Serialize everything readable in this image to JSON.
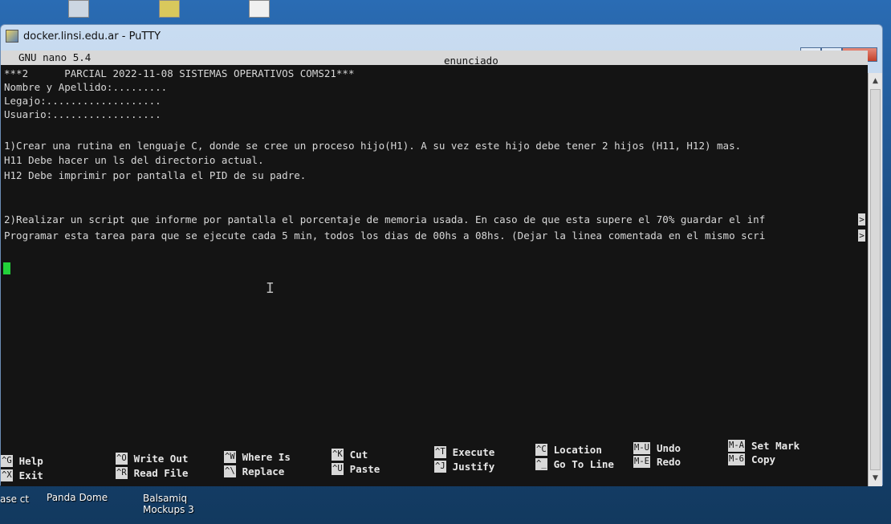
{
  "window": {
    "title": "docker.linsi.edu.ar - PuTTY",
    "buttons": [
      "–",
      "□",
      "X"
    ]
  },
  "nano": {
    "version": "GNU nano 5.4",
    "filename": "enunciado"
  },
  "document": {
    "lines": [
      "***2      PARCIAL 2022-11-08 SISTEMAS OPERATIVOS COMS21***",
      "Nombre y Apellido:.........",
      "Legajo:...................",
      "Usuario:..................",
      "",
      "1)Crear una rutina en lenguaje C, donde se cree un proceso hijo(H1). A su vez este hijo debe tener 2 hijos (H11, H12) mas.",
      "H11 Debe hacer un ls del directorio actual.",
      "H12 Debe imprimir por pantalla el PID de su padre.",
      "",
      "",
      "2)Realizar un script que informe por pantalla el porcentaje de memoria usada. En caso de que esta supere el 70% guardar el inf",
      "Programar esta tarea para que se ejecute cada 5 min, todos los dias de 00hs a 08hs. (Dejar la linea comentada en el mismo scri"
    ],
    "overflow_marker": ">"
  },
  "shortcuts": [
    {
      "key": "^G",
      "label": "Help"
    },
    {
      "key": "^X",
      "label": "Exit"
    },
    {
      "key": "^O",
      "label": "Write Out"
    },
    {
      "key": "^R",
      "label": "Read File"
    },
    {
      "key": "^W",
      "label": "Where Is"
    },
    {
      "key": "^\\",
      "label": "Replace"
    },
    {
      "key": "^K",
      "label": "Cut"
    },
    {
      "key": "^U",
      "label": "Paste"
    },
    {
      "key": "^T",
      "label": "Execute"
    },
    {
      "key": "^J",
      "label": "Justify"
    },
    {
      "key": "^C",
      "label": "Location"
    },
    {
      "key": "^_",
      "label": "Go To Line"
    },
    {
      "key": "M-U",
      "label": "Undo"
    },
    {
      "key": "M-E",
      "label": "Redo"
    },
    {
      "key": "M-A",
      "label": "Set Mark"
    },
    {
      "key": "M-6",
      "label": "Copy"
    }
  ],
  "taskbar": {
    "items": [
      "Panda Dome",
      "Balsamiq\nMockups 3",
      "ase\nct"
    ]
  }
}
